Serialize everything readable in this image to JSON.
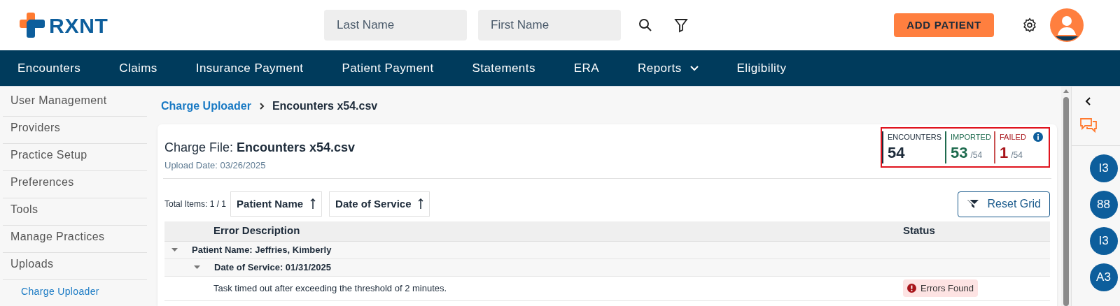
{
  "header": {
    "logo": "RXNT",
    "search_fields": [
      {
        "placeholder": "Last Name"
      },
      {
        "placeholder": "First Name"
      }
    ],
    "add_button": "ADD PATIENT"
  },
  "nav": [
    {
      "label": "Encounters",
      "dropdown": false
    },
    {
      "label": "Claims",
      "dropdown": false
    },
    {
      "label": "Insurance Payment",
      "dropdown": false
    },
    {
      "label": "Patient Payment",
      "dropdown": false
    },
    {
      "label": "Statements",
      "dropdown": false
    },
    {
      "label": "ERA",
      "dropdown": false
    },
    {
      "label": "Reports",
      "dropdown": true
    },
    {
      "label": "Eligibility",
      "dropdown": false
    }
  ],
  "sidebar": {
    "items": [
      {
        "label": "User Management",
        "selected": false
      },
      {
        "label": "Providers",
        "selected": false
      },
      {
        "label": "Practice Setup",
        "selected": false
      },
      {
        "label": "Preferences",
        "selected": false
      },
      {
        "label": "Tools",
        "selected": false
      },
      {
        "label": "Manage Practices",
        "selected": false
      },
      {
        "label": "Uploads",
        "selected": false,
        "children": [
          {
            "label": "Charge Uploader",
            "selected": true
          }
        ]
      }
    ]
  },
  "breadcrumb": [
    "Charge Uploader",
    "Encounters x54.csv"
  ],
  "file": {
    "label": "Charge File:",
    "name": "Encounters x54.csv",
    "upload_date": "Upload Date: 03/26/2025"
  },
  "stats": [
    {
      "kind": "total",
      "label": "ENCOUNTERS",
      "value": "54"
    },
    {
      "kind": "success",
      "label": "IMPORTED",
      "value": "53",
      "total": "/54"
    },
    {
      "kind": "error",
      "label": "FAILED",
      "value": "1",
      "total": "/54",
      "info": true
    }
  ],
  "toolbar": {
    "total_items": "Total Items: 1 / 1",
    "sort_buttons": [
      "Patient Name",
      "Date of Service"
    ],
    "reset_button": "Reset Grid"
  },
  "grid": {
    "columns": [
      "Error Description",
      "Status"
    ],
    "groups": [
      {
        "label": "Patient Name: Jeffries, Kimberly",
        "expanded": true,
        "children": [
          {
            "label": "Date of Service: 01/31/2025",
            "expanded": true,
            "rows": [
              {
                "error_description": "Task timed out after exceeding the threshold of 2 minutes.",
                "status": "Errors Found"
              }
            ]
          }
        ]
      }
    ]
  },
  "right_rail": {
    "avatars": [
      "I3",
      "88",
      "I3",
      "A3"
    ]
  }
}
